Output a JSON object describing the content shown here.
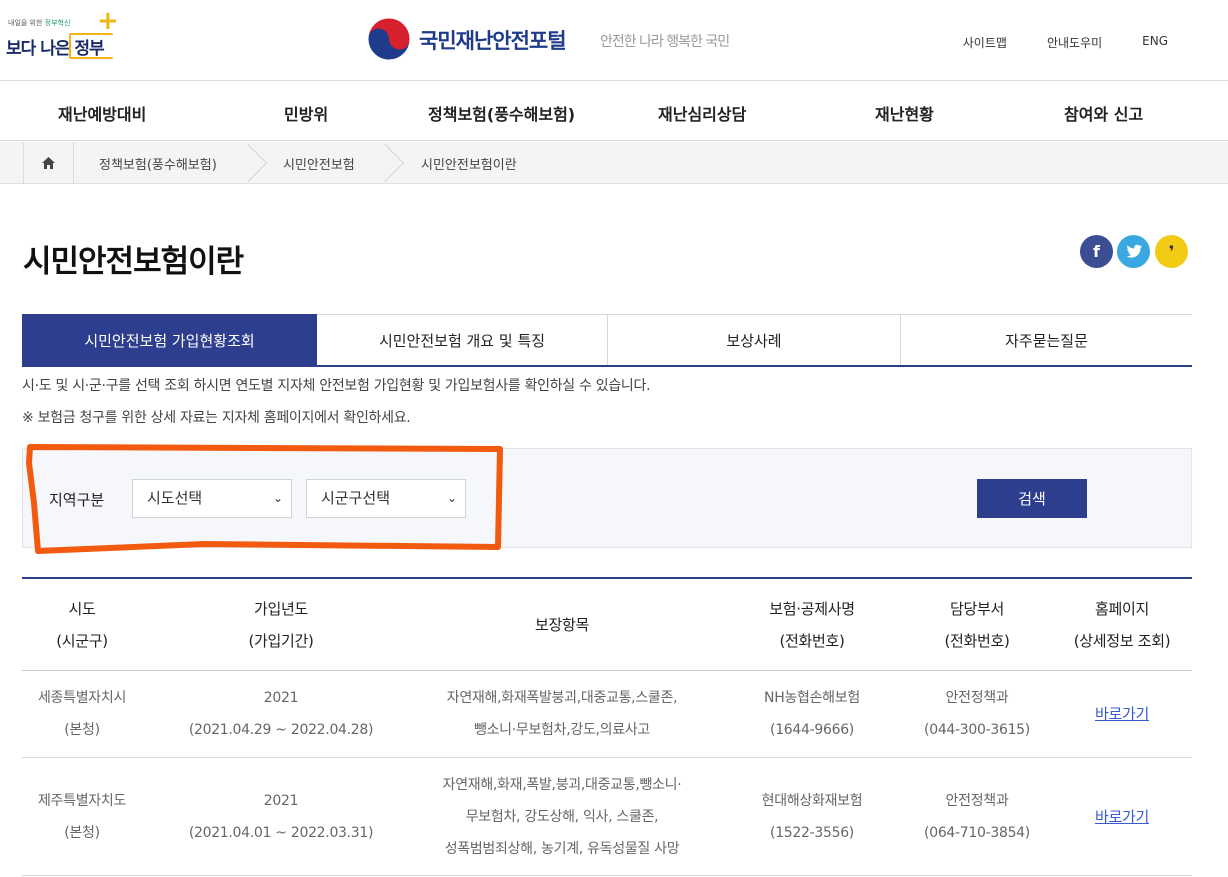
{
  "header": {
    "gov_logo": {
      "tagline_prefix": "내일을 위한 ",
      "tagline_highlight": "정부혁신",
      "text": "보다 나은 정부"
    },
    "portal_name": "국민재난안전포털",
    "slogan": "안전한 나라 행복한 국민",
    "util_links": [
      "사이트맵",
      "안내도우미",
      "ENG"
    ]
  },
  "gnb": [
    "재난예방대비",
    "민방위",
    "정책보험(풍수해보험)",
    "재난심리상담",
    "재난현황",
    "참여와 신고"
  ],
  "breadcrumb": [
    "정책보험(풍수해보험)",
    "시민안전보험",
    "시민안전보험이란"
  ],
  "page_title": "시민안전보험이란",
  "sns": {
    "facebook": "f",
    "kakao": "❜"
  },
  "tabs": [
    "시민안전보험 가입현황조회",
    "시민안전보험 개요 및 특징",
    "보상사례",
    "자주묻는질문"
  ],
  "description": [
    "시·도 및 시·군·구를 선택 조회 하시면 연도별 지자체 안전보험 가입현황 및 가입보험사를 확인하실 수 있습니다.",
    "※ 보험금 청구를 위한 상세 자료는 지자체 홈페이지에서 확인하세요."
  ],
  "search": {
    "label": "지역구분",
    "sido": "시도선택",
    "sigungu": "시군구선택",
    "button": "검색"
  },
  "table": {
    "headers": [
      [
        "시도",
        "(시군구)"
      ],
      [
        "가입년도",
        "(가입기간)"
      ],
      [
        "보장항목"
      ],
      [
        "보험·공제사명",
        "(전화번호)"
      ],
      [
        "담당부서",
        "(전화번호)"
      ],
      [
        "홈페이지",
        "(상세정보 조회)"
      ]
    ],
    "rows": [
      {
        "region": [
          "세종특별자치시",
          "(본청)"
        ],
        "year": [
          "2021",
          "(2021.04.29 ~ 2022.04.28)"
        ],
        "coverage": [
          "자연재해,화재폭발붕괴,대중교통,스쿨존,",
          "뺑소니·무보험차,강도,의료사고"
        ],
        "insurer": [
          "NH농협손해보험",
          "(1644-9666)"
        ],
        "dept": [
          "안전정책과",
          "(044-300-3615)"
        ],
        "link": "바로가기"
      },
      {
        "region": [
          "제주특별자치도",
          "(본청)"
        ],
        "year": [
          "2021",
          "(2021.04.01 ~ 2022.03.31)"
        ],
        "coverage": [
          "자연재해,화재,폭발,붕괴,대중교통,뺑소니·",
          "무보험차, 강도상해, 익사, 스쿨존,",
          "성폭범범죄상해, 농기계, 유독성물질 사망"
        ],
        "insurer": [
          "현대해상화재보험",
          "(1522-3556)"
        ],
        "dept": [
          "안전정책과",
          "(064-710-3854)"
        ],
        "link": "바로가기"
      }
    ]
  },
  "colors": {
    "primary": "#2e3e8f",
    "annotation": "#f25a0f",
    "link": "#3a5bd0"
  }
}
